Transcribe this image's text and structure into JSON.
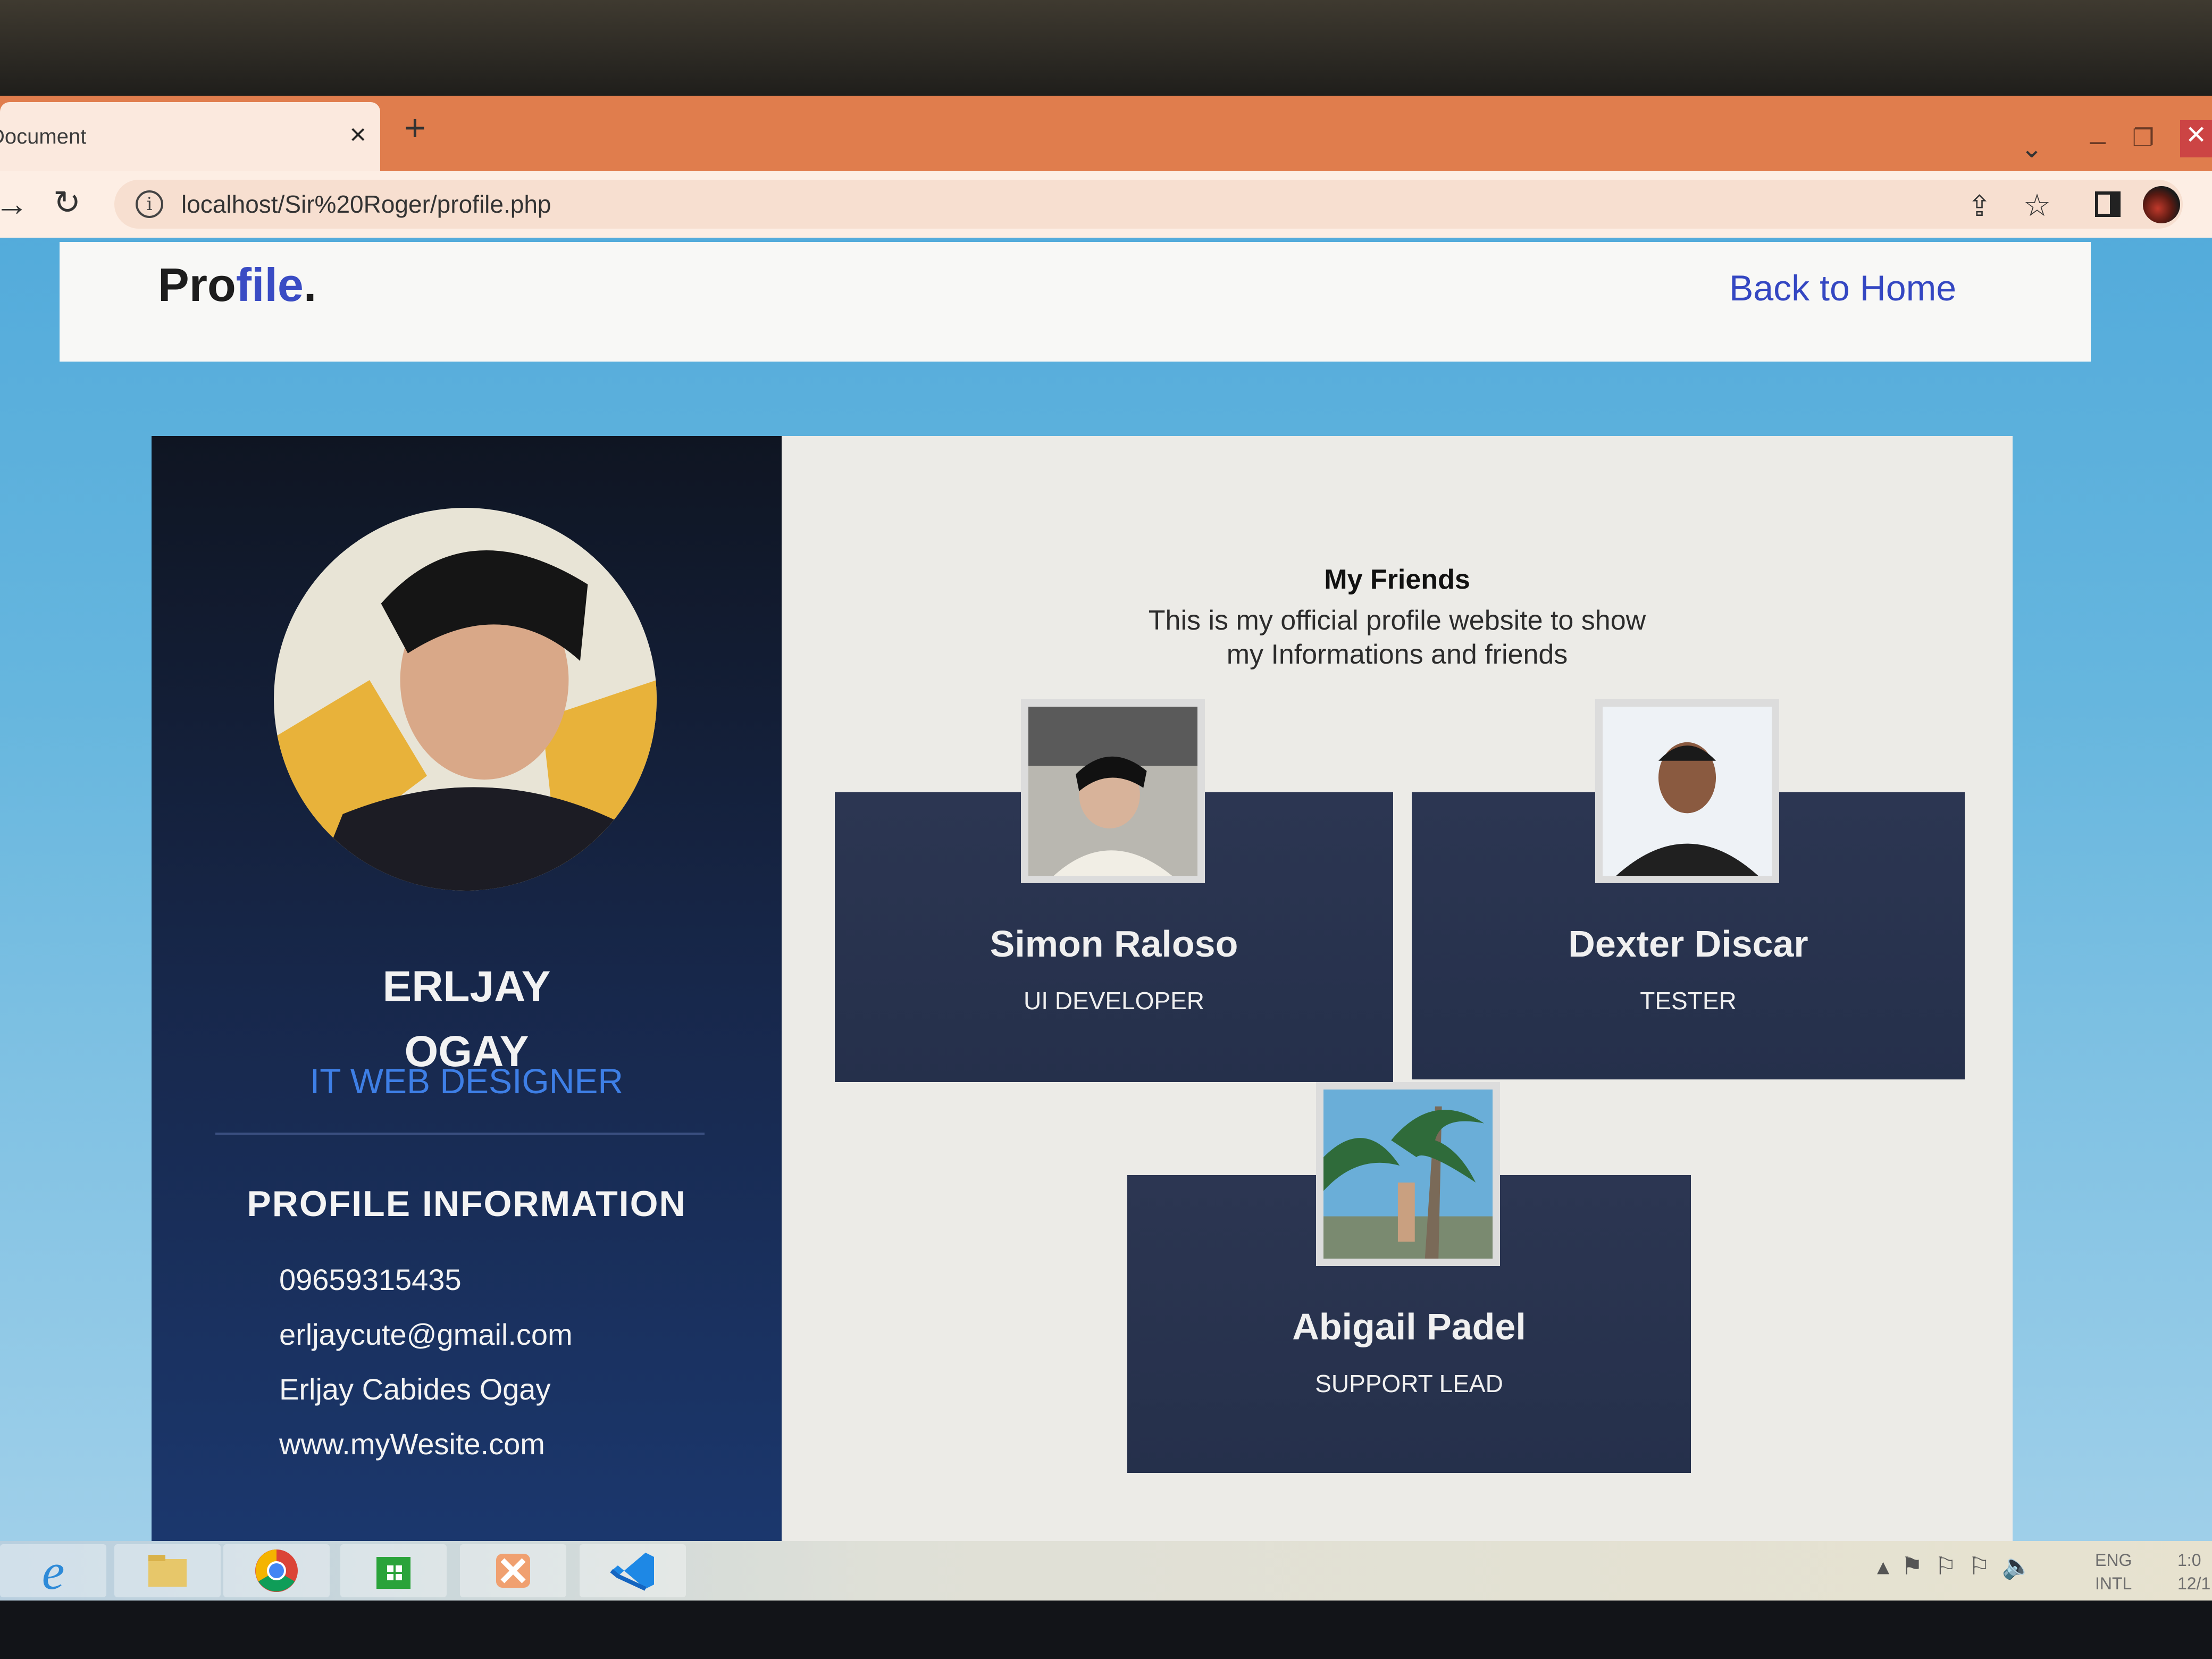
{
  "browser": {
    "tab_title": "Document",
    "tab_close": "×",
    "new_tab": "+",
    "url": "localhost/Sir%20Roger/profile.php",
    "icons": [
      "back-arrow-icon",
      "reload-icon",
      "info-icon",
      "share-icon",
      "star-icon",
      "side-panel-icon",
      "profile-avatar-icon"
    ]
  },
  "header": {
    "brand_pro": "Pro",
    "brand_file": "file",
    "brand_dot": ".",
    "back_link": "Back to Home"
  },
  "profile": {
    "first_name": "ERLJAY",
    "last_name": "OGAY",
    "role": "IT WEB DESIGNER",
    "info_heading": "PROFILE INFORMATION",
    "phone": "09659315435",
    "email": "erljaycute@gmail.com",
    "full_name": "Erljay Cabides Ogay",
    "website": "www.myWesite.com"
  },
  "friends": {
    "title": "My Friends",
    "desc_line1": "This is my official profile website to show",
    "desc_line2": "my Informations and friends",
    "items": [
      {
        "name": "Simon Raloso",
        "role": "UI DEVELOPER"
      },
      {
        "name": "Dexter Discar",
        "role": "TESTER"
      },
      {
        "name": "Abigail Padel",
        "role": "SUPPORT LEAD"
      }
    ]
  },
  "taskbar": {
    "apps": [
      "internet-explorer-icon",
      "file-explorer-icon",
      "chrome-icon",
      "store-icon",
      "xampp-icon",
      "vscode-icon"
    ],
    "lang_line1": "ENG",
    "lang_line2": "INTL",
    "clock_line1": "1:0",
    "clock_line2": "12/1"
  },
  "colors": {
    "accent_blue": "#3447c2",
    "panel_dark": "#17274a",
    "card_navy": "#2b3550",
    "role_blue": "#3e7fe6",
    "tab_orange": "#e07d4d"
  }
}
